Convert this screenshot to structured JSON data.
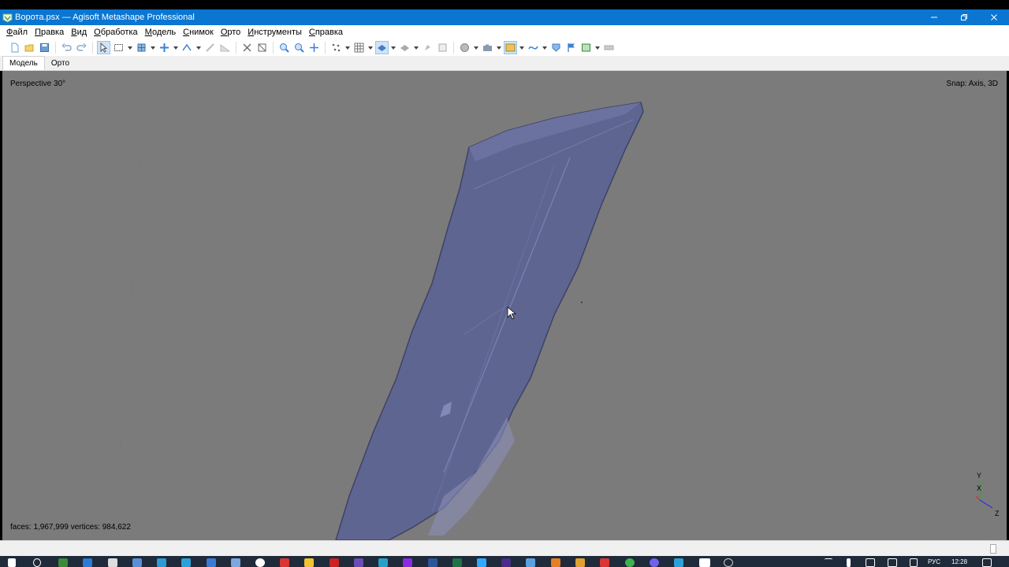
{
  "window": {
    "title": "Ворота.psx — Agisoft Metashape Professional",
    "controls": [
      "minimize",
      "restore",
      "close"
    ]
  },
  "menu": {
    "items": [
      "Файл",
      "Правка",
      "Вид",
      "Обработка",
      "Модель",
      "Снимок",
      "Орто",
      "Инструменты",
      "Справка"
    ]
  },
  "toolbar": {
    "buttons": [
      "new-icon",
      "open-icon",
      "save-icon",
      "undo-icon",
      "redo-icon",
      "select-arrow-icon",
      "rect-select-icon",
      "region-icon",
      "move-icon",
      "ruler-icon",
      "draw-polyline-icon",
      "draw-polygon-icon",
      "delete-icon",
      "crop-icon",
      "zoom-in-icon",
      "zoom-out-icon",
      "navigate-icon",
      "points-icon",
      "grid-icon",
      "model-view-icon",
      "texture-view-icon",
      "sphere-icon",
      "camera-icon",
      "photo-icon",
      "curve-icon",
      "shield-icon",
      "flag-icon",
      "image-icon",
      "measure-icon"
    ]
  },
  "tabs": [
    {
      "label": "Модель",
      "active": true
    },
    {
      "label": "Орто",
      "active": false
    }
  ],
  "viewport": {
    "projection": "Perspective 30°",
    "snap": "Snap: Axis, 3D",
    "stats": "faces: 1,967,999 vertices: 984,622",
    "background_color": "#7b7b7b",
    "model_color": "#5f6591",
    "axes": {
      "y": "Y",
      "x": "X",
      "z": "Z"
    }
  },
  "taskbar": {
    "language": "РУС",
    "time": "12:28"
  }
}
